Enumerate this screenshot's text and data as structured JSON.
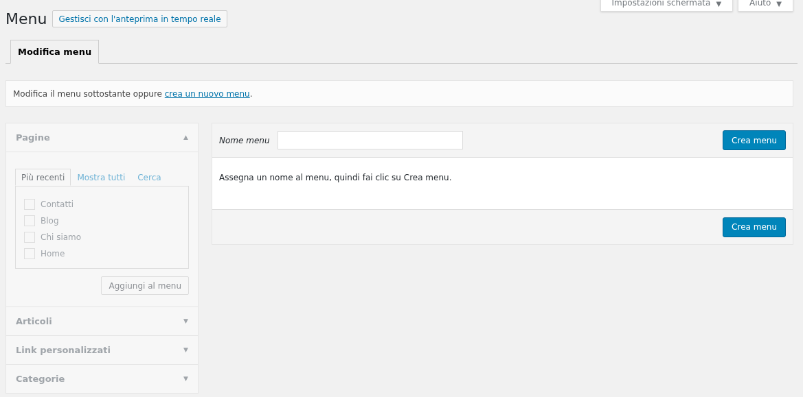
{
  "screen_options": [
    {
      "label": "Impostazioni schermata",
      "icon": "▼"
    },
    {
      "label": "Aiuto",
      "icon": "▼"
    }
  ],
  "page_title": "Menu",
  "live_preview_button": "Gestisci con l'anteprima in tempo reale",
  "tabs": [
    {
      "label": "Modifica menu",
      "selected": true
    }
  ],
  "notice": {
    "text": "Modifica il menu sottostante oppure ",
    "link": "crea un nuovo menu",
    "end": "."
  },
  "accordion": [
    {
      "title": "Pagine",
      "icon": "▲",
      "expanded": true,
      "disabled": true,
      "tabs": [
        {
          "label": "Più recenti",
          "selected": true
        },
        {
          "label": "Mostra tutti",
          "selected": false
        },
        {
          "label": "Cerca",
          "selected": false
        }
      ],
      "items": [
        {
          "label": "Contatti",
          "checked": false
        },
        {
          "label": "Blog",
          "checked": false
        },
        {
          "label": "Chi siamo",
          "checked": false
        },
        {
          "label": "Home",
          "checked": false
        }
      ],
      "add_button": "Aggiungi al menu"
    },
    {
      "title": "Articoli",
      "icon": "▼",
      "expanded": false,
      "disabled": true
    },
    {
      "title": "Link personalizzati",
      "icon": "▼",
      "expanded": false,
      "disabled": true
    },
    {
      "title": "Categorie",
      "icon": "▼",
      "expanded": false,
      "disabled": true
    }
  ],
  "editor": {
    "name_label": "Nome menu",
    "create_button": "Crea menu",
    "instructions": "Assegna un nome al menu, quindi fai clic su Crea menu.",
    "footer_button": "Crea menu"
  }
}
